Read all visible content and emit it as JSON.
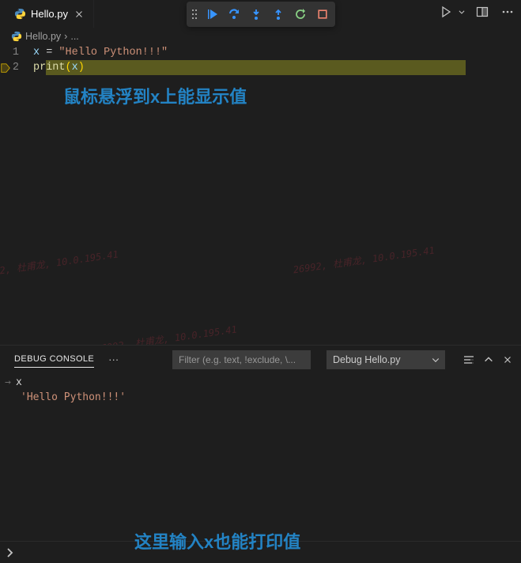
{
  "tab": {
    "label": "Hello.py"
  },
  "breadcrumb": {
    "file": "Hello.py",
    "sep": "›",
    "ellipsis": "..."
  },
  "code": {
    "line1": {
      "num": "1",
      "var": "x",
      "eq": " = ",
      "str": "\"Hello Python!!!\""
    },
    "line2": {
      "num": "2",
      "fn": "print",
      "lpar": "(",
      "arg": "x",
      "rpar": ")"
    }
  },
  "annotation": {
    "hover": "鼠标悬浮到x上能显示值",
    "input": "这里输入x也能打印值"
  },
  "panel": {
    "tab": "DEBUG CONSOLE",
    "more": "···",
    "filter_placeholder": "Filter (e.g. text, !exclude, \\...",
    "launch": "Debug Hello.py",
    "input_expr": "x",
    "output_value": "'Hello Python!!!'"
  },
  "watermark": "26992, 杜甫龙, 10.0.195.41"
}
